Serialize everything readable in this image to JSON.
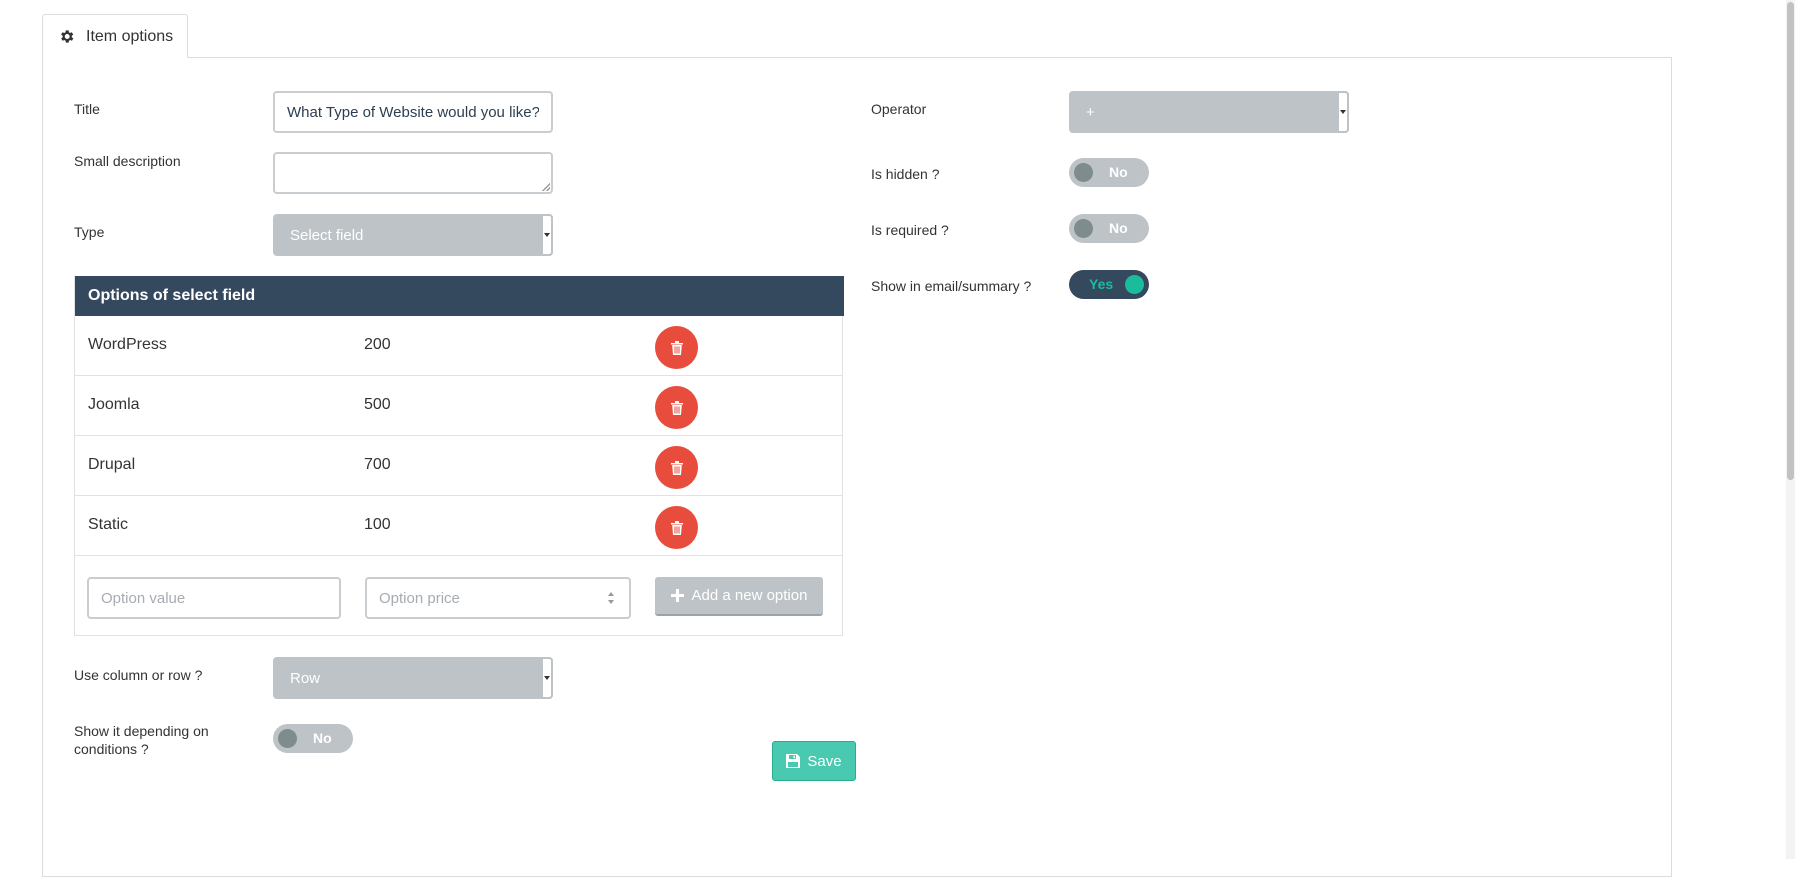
{
  "tab": {
    "label": "Item options",
    "icon": "gear-icon"
  },
  "form": {
    "title": {
      "label": "Title",
      "value": "What Type of Website would you like?"
    },
    "small_description": {
      "label": "Small description",
      "value": ""
    },
    "type": {
      "label": "Type",
      "value": "Select field"
    },
    "options_table": {
      "header": "Options of select field",
      "rows": [
        {
          "name": "WordPress",
          "price": "200"
        },
        {
          "name": "Joomla",
          "price": "500"
        },
        {
          "name": "Drupal",
          "price": "700"
        },
        {
          "name": "Static",
          "price": "100"
        }
      ],
      "new_option": {
        "value_placeholder": "Option value",
        "price_placeholder": "Option price",
        "add_label": "Add a new option"
      }
    },
    "use_column_or_row": {
      "label": "Use column or row ?",
      "value": "Row"
    },
    "show_depending_on_conditions": {
      "label": "Show it depending on conditions ?",
      "value": "No",
      "on": false
    },
    "operator": {
      "label": "Operator",
      "value": "+"
    },
    "is_hidden": {
      "label": "Is hidden ?",
      "value": "No",
      "on": false
    },
    "is_required": {
      "label": "Is required ?",
      "value": "No",
      "on": false
    },
    "show_in_email_summary": {
      "label": "Show in email/summary ?",
      "value": "Yes",
      "on": true
    },
    "save_label": "Save"
  },
  "colors": {
    "header_bg": "#34495e",
    "select_bg": "#bdc3c7",
    "delete_red": "#e74c3c",
    "save_green": "#48c9b0",
    "toggle_on_knob": "#1abc9c"
  }
}
